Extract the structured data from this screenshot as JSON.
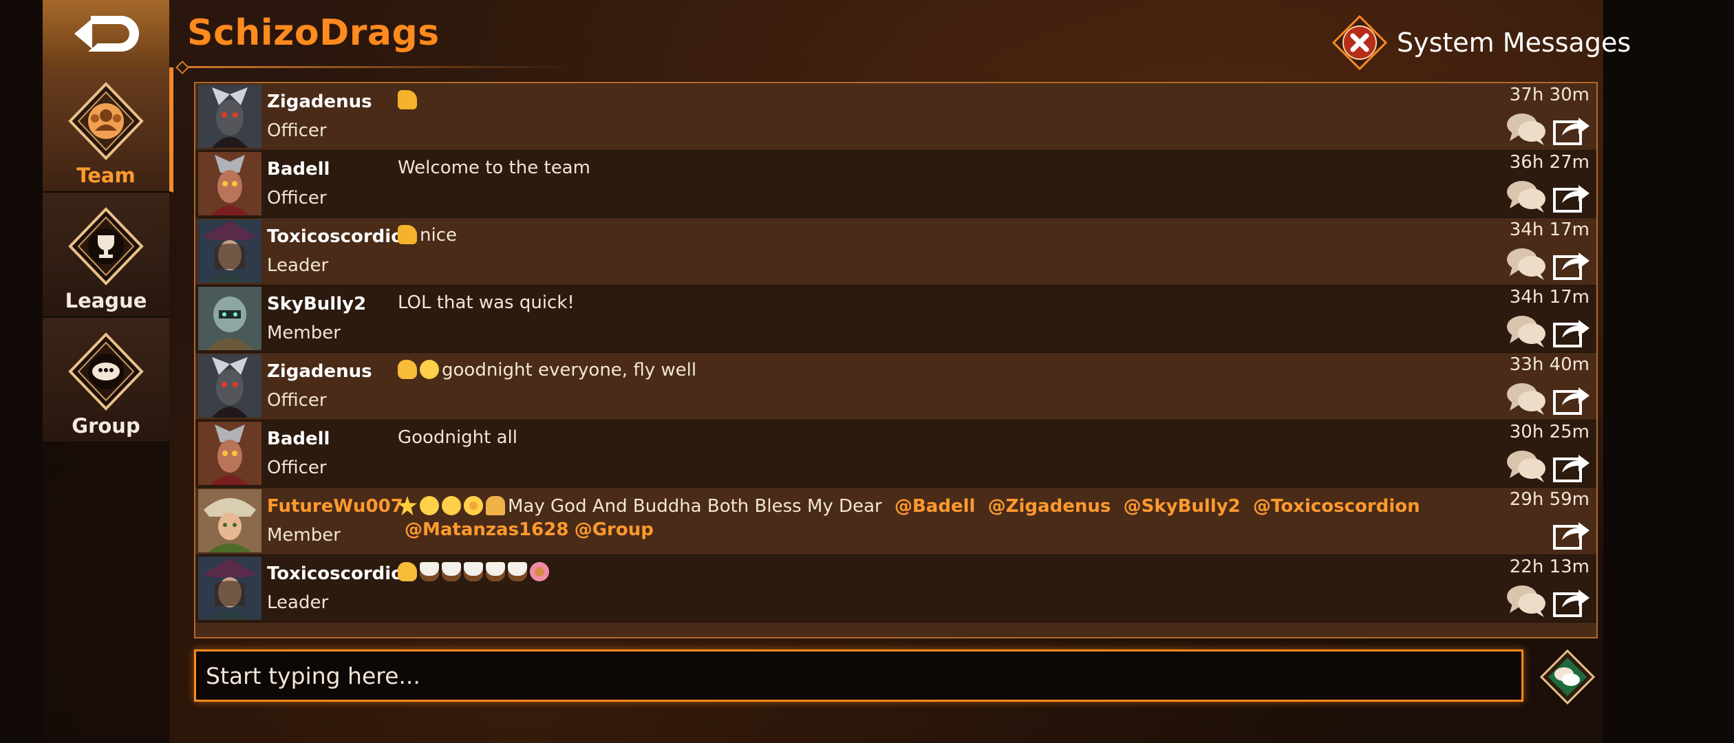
{
  "team": {
    "name": "SchizoDrags"
  },
  "header": {
    "system_messages_label": "System Messages"
  },
  "sidenav": {
    "items": [
      {
        "label": "Team",
        "active": true
      },
      {
        "label": "League",
        "active": false
      },
      {
        "label": "Group",
        "active": false
      }
    ]
  },
  "messages": [
    {
      "user": "Zigadenus",
      "role": "Officer",
      "text": "",
      "emojis": [
        "thumbs-up"
      ],
      "time": "37h 30m",
      "reply": true,
      "highlight": false
    },
    {
      "user": "Badell",
      "role": "Officer",
      "text": "Welcome to the team",
      "emojis": [],
      "time": "36h 27m",
      "reply": true,
      "highlight": false
    },
    {
      "user": "Toxicoscordion",
      "role": "Leader",
      "text": "nice",
      "emojis": [
        "thumbs-up"
      ],
      "time": "34h 17m",
      "reply": true,
      "highlight": false
    },
    {
      "user": "SkyBully2",
      "role": "Member",
      "text": "LOL that was quick!",
      "emojis": [],
      "time": "34h 17m",
      "reply": true,
      "highlight": false
    },
    {
      "user": "Zigadenus",
      "role": "Officer",
      "text": "goodnight everyone,  fly well",
      "emojis": [
        "wave",
        "yawn"
      ],
      "time": "33h 40m",
      "reply": true,
      "highlight": false
    },
    {
      "user": "Badell",
      "role": "Officer",
      "text": "Goodnight all",
      "emojis": [],
      "time": "30h 25m",
      "reply": true,
      "highlight": false
    },
    {
      "user": "FutureWu007",
      "role": "Member",
      "text": "May God And Buddha Both Bless My Dear",
      "emojis": [
        "star",
        "halo",
        "relieved",
        "heart-eyes",
        "pray"
      ],
      "mentions": [
        "@Badell",
        "@Zigadenus",
        "@SkyBully2",
        "@Toxicoscordion",
        "@Matanzas1628",
        "@Group"
      ],
      "time": "29h 59m",
      "reply": false,
      "highlight": true
    },
    {
      "user": "Toxicoscordion",
      "role": "Leader",
      "text": "",
      "emojis": [
        "wave",
        "coffee",
        "coffee",
        "coffee",
        "coffee",
        "coffee",
        "donut"
      ],
      "time": "22h 13m",
      "reply": true,
      "highlight": false
    }
  ],
  "input": {
    "placeholder": "Start typing here..."
  },
  "colors": {
    "accent": "#ff8a1e",
    "row_light": "#4a2b18",
    "row_dark": "#2c1a0f",
    "border": "#b26a2a"
  }
}
